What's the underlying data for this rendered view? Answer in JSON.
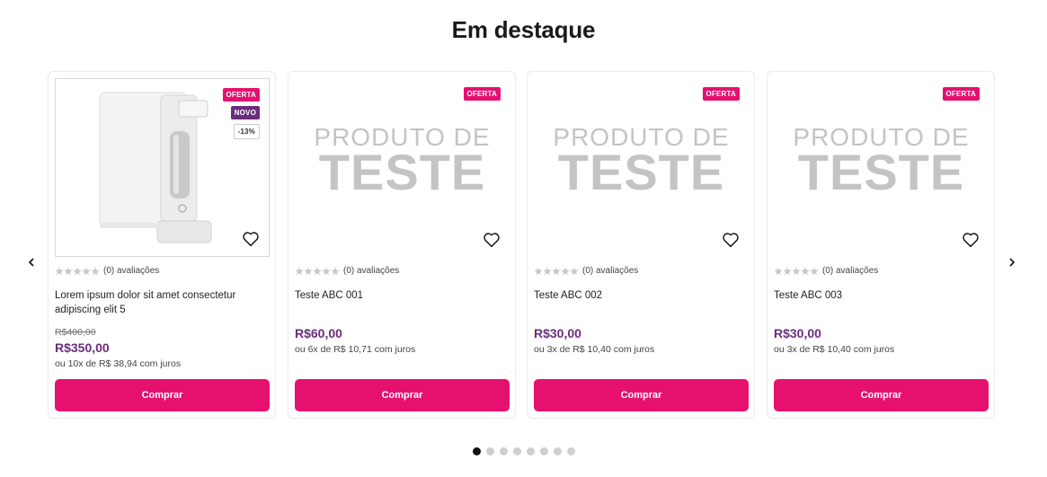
{
  "section": {
    "title": "Em destaque"
  },
  "colors": {
    "accent": "#e6116f",
    "price": "#6b2c7d"
  },
  "carousel": {
    "prev_icon": "chevron-left-icon",
    "next_icon": "chevron-right-icon",
    "dots_count": 8,
    "active_dot": 0
  },
  "products": [
    {
      "badges": {
        "oferta": "OFERTA",
        "novo": "NOVO",
        "desconto": "-13%"
      },
      "rating_text": "(0) avaliações",
      "name": "Lorem ipsum dolor sit amet consectetur adipiscing elit 5",
      "price_old": "R$400,00",
      "price": "R$350,00",
      "installment": "ou 10x de R$ 38,94 com juros",
      "button": "Comprar"
    },
    {
      "badges": {
        "oferta": "OFERTA"
      },
      "placeholder_line1": "PRODUTO DE",
      "placeholder_line2": "TESTE",
      "rating_text": "(0) avaliações",
      "name": "Teste ABC 001",
      "price": "R$60,00",
      "installment": "ou 6x de R$ 10,71 com juros",
      "button": "Comprar"
    },
    {
      "badges": {
        "oferta": "OFERTA"
      },
      "placeholder_line1": "PRODUTO DE",
      "placeholder_line2": "TESTE",
      "rating_text": "(0) avaliações",
      "name": "Teste ABC 002",
      "price": "R$30,00",
      "installment": "ou 3x de R$ 10,40 com juros",
      "button": "Comprar"
    },
    {
      "badges": {
        "oferta": "OFERTA"
      },
      "placeholder_line1": "PRODUTO DE",
      "placeholder_line2": "TESTE",
      "rating_text": "(0) avaliações",
      "name": "Teste ABC 003",
      "price": "R$30,00",
      "installment": "ou 3x de R$ 10,40 com juros",
      "button": "Comprar"
    }
  ]
}
